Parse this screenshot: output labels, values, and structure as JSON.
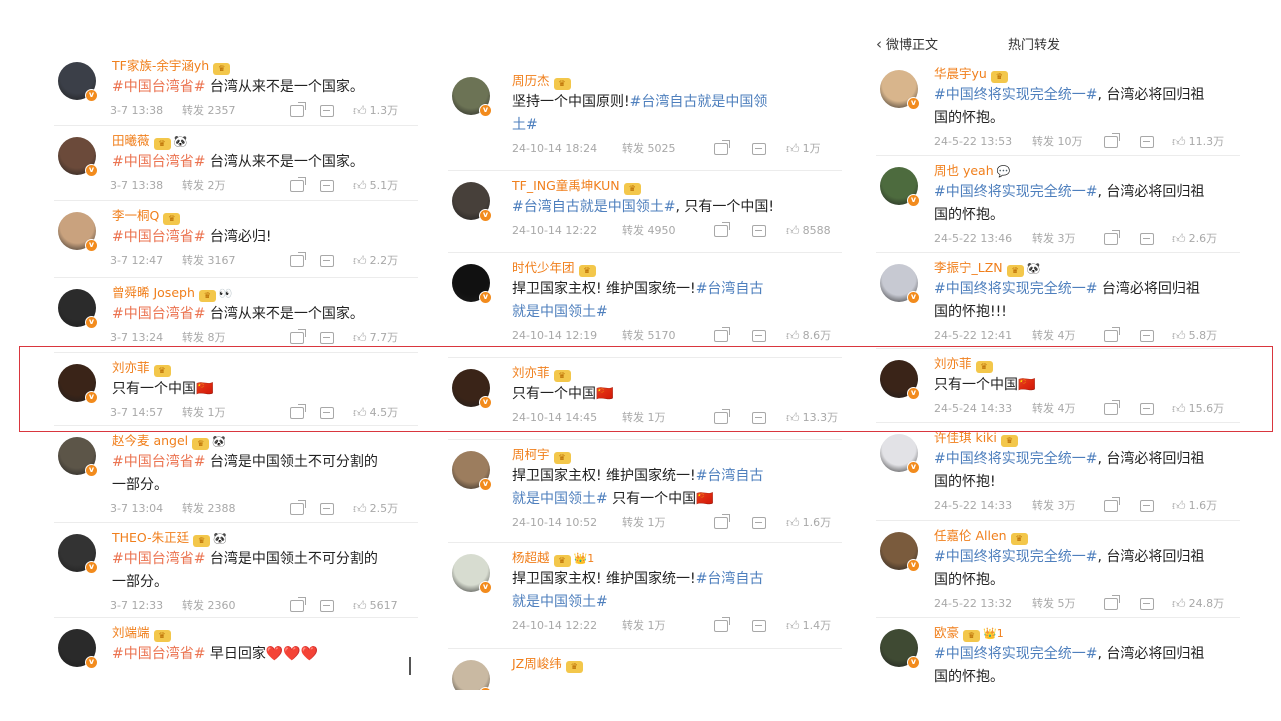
{
  "columns": [
    {
      "header": {
        "left": "",
        "right": ""
      },
      "posts": [
        {
          "user": "TF家族-余宇涵yh",
          "crown": true,
          "extra": "",
          "text": [
            {
              "t": "#中国台湾省#",
              "tag": true
            },
            {
              "t": " 台湾从来不是一个国家。",
              "tag": false
            }
          ],
          "date": "3-7 13:38",
          "repost": "转发 2357",
          "likes": "1.3万",
          "avatar_color": "#3b3f48"
        },
        {
          "user": "田曦薇",
          "crown": true,
          "extra": "🐼",
          "text": [
            {
              "t": "#中国台湾省#",
              "tag": true
            },
            {
              "t": " 台湾从来不是一个国家。",
              "tag": false
            }
          ],
          "date": "3-7 13:38",
          "repost": "转发 2万",
          "likes": "5.1万",
          "avatar_color": "#6b4a3a"
        },
        {
          "user": "李一桐Q",
          "crown": true,
          "extra": "",
          "text": [
            {
              "t": "#中国台湾省#",
              "tag": true
            },
            {
              "t": " 台湾必归!",
              "tag": false
            }
          ],
          "date": "3-7 12:47",
          "repost": "转发 3167",
          "likes": "2.2万",
          "avatar_color": "#c9a27e"
        },
        {
          "user": "曾舜晞 Joseph",
          "crown": true,
          "extra": "👀",
          "text": [
            {
              "t": "#中国台湾省#",
              "tag": true
            },
            {
              "t": " 台湾从来不是一个国家。",
              "tag": false
            }
          ],
          "date": "3-7 13:24",
          "repost": "转发 8万",
          "likes": "7.7万",
          "avatar_color": "#2b2b2b"
        },
        {
          "user": "刘亦菲",
          "crown": true,
          "extra": "",
          "text": [
            {
              "t": "只有一个中国",
              "tag": false
            },
            {
              "t": "🇨🇳",
              "tag": false
            }
          ],
          "date": "3-7 14:57",
          "repost": "转发 1万",
          "likes": "4.5万",
          "avatar_color": "#3a2418"
        },
        {
          "user": "赵今麦 angel",
          "crown": true,
          "extra": "🐼",
          "text": [
            {
              "t": "#中国台湾省#",
              "tag": true
            },
            {
              "t": " 台湾是中国领土不可分割的\n一部分。",
              "tag": false
            }
          ],
          "date": "3-7 13:04",
          "repost": "转发 2388",
          "likes": "2.5万",
          "avatar_color": "#5c5548"
        },
        {
          "user": "THEO-朱正廷",
          "crown": true,
          "extra": "🐼",
          "text": [
            {
              "t": "#中国台湾省#",
              "tag": true
            },
            {
              "t": " 台湾是中国领土不可分割的\n一部分。",
              "tag": false
            }
          ],
          "date": "3-7 12:33",
          "repost": "转发 2360",
          "likes": "5617",
          "avatar_color": "#333333"
        },
        {
          "user": "刘端端",
          "crown": true,
          "extra": "",
          "text": [
            {
              "t": "#中国台湾省#",
              "tag": true
            },
            {
              "t": " 早日回家❤️❤️❤️",
              "tag": false
            }
          ],
          "date": "",
          "repost": "",
          "likes": "",
          "avatar_color": "#2a2a2a"
        }
      ]
    },
    {
      "header": {
        "left": "",
        "right": ""
      },
      "posts": [
        {
          "user": "周历杰",
          "crown": true,
          "extra": "",
          "text": [
            {
              "t": "坚持一个中国原则!",
              "tag": false
            },
            {
              "t": "#台湾自古就是中国领\n土#",
              "tag": true
            }
          ],
          "date": "24-10-14 18:24",
          "repost": "转发 5025",
          "likes": "1万",
          "avatar_color": "#6c7355"
        },
        {
          "user": "TF_ING童禹坤KUN",
          "crown": true,
          "extra": "",
          "text": [
            {
              "t": "#台湾自古就是中国领土#",
              "tag": true
            },
            {
              "t": ", 只有一个中国!",
              "tag": false
            }
          ],
          "date": "24-10-14 12:22",
          "repost": "转发 4950",
          "likes": "8588",
          "avatar_color": "#47403a"
        },
        {
          "user": "时代少年团",
          "crown": true,
          "extra": "",
          "text": [
            {
              "t": "捍卫国家主权! 维护国家统一!",
              "tag": false
            },
            {
              "t": "#台湾自古\n就是中国领土#",
              "tag": true
            }
          ],
          "date": "24-10-14 12:19",
          "repost": "转发 5170",
          "likes": "8.6万",
          "avatar_color": "#111111"
        },
        {
          "user": "刘亦菲",
          "crown": true,
          "extra": "",
          "text": [
            {
              "t": "只有一个中国",
              "tag": false
            },
            {
              "t": "🇨🇳",
              "tag": false
            }
          ],
          "date": "24-10-14 14:45",
          "repost": "转发 1万",
          "likes": "13.3万",
          "avatar_color": "#3a2418"
        },
        {
          "user": "周柯宇",
          "crown": true,
          "extra": "",
          "text": [
            {
              "t": "捍卫国家主权! 维护国家统一!",
              "tag": false
            },
            {
              "t": "#台湾自古\n就是中国领土#",
              "tag": true
            },
            {
              "t": " 只有一个中国🇨🇳",
              "tag": false
            }
          ],
          "date": "24-10-14 10:52",
          "repost": "转发 1万",
          "likes": "1.6万",
          "avatar_color": "#9c7d5e"
        },
        {
          "user": "杨超越",
          "crown": true,
          "extra": "👑1",
          "text": [
            {
              "t": "捍卫国家主权! 维护国家统一!",
              "tag": false
            },
            {
              "t": "#台湾自古\n就是中国领土#",
              "tag": true
            }
          ],
          "date": "24-10-14 12:22",
          "repost": "转发 1万",
          "likes": "1.4万",
          "avatar_color": "#d7dcd0"
        },
        {
          "user": "JZ周峻纬",
          "crown": true,
          "extra": "",
          "text": [],
          "date": "",
          "repost": "",
          "likes": "",
          "avatar_color": "#c9b9a2"
        }
      ]
    },
    {
      "header": {
        "left": "微博正文",
        "right": "热门转发"
      },
      "posts": [
        {
          "user": "华晨宇yu",
          "crown": true,
          "extra": "",
          "text": [
            {
              "t": "#中国终将实现完全统一#",
              "tag": true
            },
            {
              "t": ", 台湾必将回归祖\n国的怀抱。",
              "tag": false
            }
          ],
          "date": "24-5-22 13:53",
          "repost": "转发 10万",
          "likes": "11.3万",
          "avatar_color": "#d8b58c"
        },
        {
          "user": "周也 yeah",
          "crown": false,
          "extra": "💬",
          "text": [
            {
              "t": "#中国终将实现完全统一#",
              "tag": true
            },
            {
              "t": ", 台湾必将回归祖\n国的怀抱。",
              "tag": false
            }
          ],
          "date": "24-5-22 13:46",
          "repost": "转发 3万",
          "likes": "2.6万",
          "avatar_color": "#4d6b3e"
        },
        {
          "user": "李振宁_LZN",
          "crown": true,
          "extra": "🐼",
          "text": [
            {
              "t": "#中国终将实现完全统一#",
              "tag": true
            },
            {
              "t": " 台湾必将回归祖\n国的怀抱!!!",
              "tag": false
            }
          ],
          "date": "24-5-22 12:41",
          "repost": "转发 4万",
          "likes": "5.8万",
          "avatar_color": "#c7c9d2"
        },
        {
          "user": "刘亦菲",
          "crown": true,
          "extra": "",
          "text": [
            {
              "t": "只有一个中国",
              "tag": false
            },
            {
              "t": "🇨🇳",
              "tag": false
            }
          ],
          "date": "24-5-24 14:33",
          "repost": "转发 4万",
          "likes": "15.6万",
          "avatar_color": "#3a2418"
        },
        {
          "user": "许佳琪 kiki",
          "crown": true,
          "extra": "",
          "text": [
            {
              "t": "#中国终将实现完全统一#",
              "tag": true
            },
            {
              "t": ", 台湾必将回归祖\n国的怀抱!",
              "tag": false
            }
          ],
          "date": "24-5-22 14:33",
          "repost": "转发 3万",
          "likes": "1.6万",
          "avatar_color": "#e2e2e6"
        },
        {
          "user": "任嘉伦 Allen",
          "crown": true,
          "extra": "",
          "text": [
            {
              "t": "#中国终将实现完全统一#",
              "tag": true
            },
            {
              "t": ", 台湾必将回归祖\n国的怀抱。",
              "tag": false
            }
          ],
          "date": "24-5-22 13:32",
          "repost": "转发 5万",
          "likes": "24.8万",
          "avatar_color": "#7a5b3d"
        },
        {
          "user": "欧豪",
          "crown": true,
          "extra": "👑1",
          "text": [
            {
              "t": "#中国终将实现完全统一#",
              "tag": true
            },
            {
              "t": ", 台湾必将回归祖\n国的怀抱。",
              "tag": false
            }
          ],
          "date": "",
          "repost": "",
          "likes": "",
          "avatar_color": "#3f4a33"
        }
      ]
    }
  ]
}
